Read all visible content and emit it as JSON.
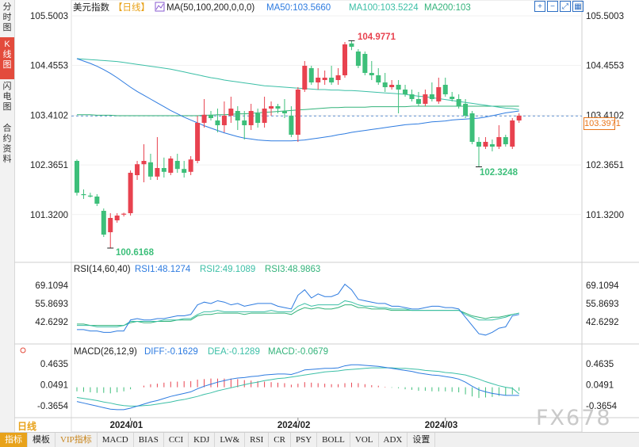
{
  "side_tabs": [
    {
      "label": "分时图",
      "active": false
    },
    {
      "label": "K线图",
      "active": true
    },
    {
      "label": "闪电图",
      "active": false
    },
    {
      "label": "合约资料",
      "active": false
    }
  ],
  "header": {
    "instrument": "美元指数",
    "period_tag": "【日线】",
    "ma_label": "MA(50,100,200,0,0,0)",
    "ma50": "MA50:103.5660",
    "ma100": "MA100:103.5224",
    "ma200": "MA200:103"
  },
  "price_axis_labels": [
    "105.5003",
    "104.4553",
    "103.4102",
    "102.3651",
    "101.3200"
  ],
  "current_price": "103.3971",
  "annotations": {
    "high": "104.9771",
    "low1": "100.6168",
    "low2": "102.3248"
  },
  "rsi_header": {
    "label": "RSI(14,60,40)",
    "rsi1": "RSI1:48.1274",
    "rsi2": "RSI2:49.1089",
    "rsi3": "RSI3:48.9863"
  },
  "rsi_axis_labels": [
    "69.1094",
    "55.8693",
    "42.6292"
  ],
  "macd_header": {
    "label": "MACD(26,12,9)",
    "diff": "DIFF:-0.1629",
    "dea": "DEA:-0.1289",
    "macd": "MACD:-0.0679"
  },
  "macd_axis_labels": [
    "0.4635",
    "0.0491",
    "-0.3654"
  ],
  "date_labels": [
    "2024/01",
    "2024/02",
    "2024/03"
  ],
  "period_button": "日线",
  "watermark": "FX678",
  "toolbar": [
    "指标",
    "模板",
    "VIP指标",
    "MACD",
    "BIAS",
    "CCI",
    "KDJ",
    "LW&",
    "RSI",
    "CR",
    "PSY",
    "BOLL",
    "VOL",
    "ADX",
    "设置"
  ],
  "colors": {
    "up": "#e8424f",
    "down": "#3dbf7a",
    "ma50": "#2d7be0",
    "ma100": "#3bbfa6",
    "ma200": "#33b37a",
    "accent": "#e8a21a"
  },
  "chart_data": {
    "type": "candlestick",
    "price_range": [
      100.5,
      105.5
    ],
    "candles": [
      {
        "o": 102.45,
        "h": 102.48,
        "l": 101.72,
        "c": 101.78
      },
      {
        "o": 101.75,
        "h": 101.85,
        "l": 101.65,
        "c": 101.73
      },
      {
        "o": 101.72,
        "h": 101.78,
        "l": 101.68,
        "c": 101.7
      },
      {
        "o": 101.7,
        "h": 101.75,
        "l": 101.5,
        "c": 101.55
      },
      {
        "o": 101.4,
        "h": 101.45,
        "l": 100.85,
        "c": 100.9
      },
      {
        "o": 100.95,
        "h": 101.35,
        "l": 100.62,
        "c": 101.25
      },
      {
        "o": 101.2,
        "h": 101.35,
        "l": 101.15,
        "c": 101.3
      },
      {
        "o": 101.32,
        "h": 101.36,
        "l": 101.28,
        "c": 101.34
      },
      {
        "o": 101.35,
        "h": 102.25,
        "l": 101.3,
        "c": 102.2
      },
      {
        "o": 102.15,
        "h": 102.45,
        "l": 102.05,
        "c": 102.38
      },
      {
        "o": 102.38,
        "h": 102.8,
        "l": 102.0,
        "c": 102.45
      },
      {
        "o": 102.42,
        "h": 102.6,
        "l": 102.05,
        "c": 102.12
      },
      {
        "o": 102.12,
        "h": 102.95,
        "l": 102.05,
        "c": 102.3
      },
      {
        "o": 102.3,
        "h": 102.52,
        "l": 102.1,
        "c": 102.22
      },
      {
        "o": 102.2,
        "h": 102.55,
        "l": 102.15,
        "c": 102.5
      },
      {
        "o": 102.45,
        "h": 102.6,
        "l": 102.2,
        "c": 102.28
      },
      {
        "o": 102.28,
        "h": 102.45,
        "l": 102.1,
        "c": 102.2
      },
      {
        "o": 102.22,
        "h": 102.55,
        "l": 102.15,
        "c": 102.48
      },
      {
        "o": 102.45,
        "h": 103.4,
        "l": 102.4,
        "c": 103.25
      },
      {
        "o": 103.25,
        "h": 103.75,
        "l": 103.15,
        "c": 103.42
      },
      {
        "o": 103.42,
        "h": 103.5,
        "l": 103.3,
        "c": 103.35
      },
      {
        "o": 103.3,
        "h": 103.55,
        "l": 103.05,
        "c": 103.2
      },
      {
        "o": 103.2,
        "h": 103.7,
        "l": 103.05,
        "c": 103.4
      },
      {
        "o": 103.4,
        "h": 103.8,
        "l": 103.25,
        "c": 103.55
      },
      {
        "o": 103.5,
        "h": 103.6,
        "l": 103.1,
        "c": 103.3
      },
      {
        "o": 103.3,
        "h": 103.5,
        "l": 102.9,
        "c": 103.2
      },
      {
        "o": 103.2,
        "h": 103.65,
        "l": 103.1,
        "c": 103.5
      },
      {
        "o": 103.45,
        "h": 103.55,
        "l": 103.15,
        "c": 103.25
      },
      {
        "o": 103.25,
        "h": 103.8,
        "l": 103.15,
        "c": 103.55
      },
      {
        "o": 103.55,
        "h": 103.7,
        "l": 103.4,
        "c": 103.6
      },
      {
        "o": 103.6,
        "h": 103.65,
        "l": 103.45,
        "c": 103.55
      },
      {
        "o": 103.5,
        "h": 103.75,
        "l": 103.35,
        "c": 103.45
      },
      {
        "o": 103.4,
        "h": 103.6,
        "l": 102.95,
        "c": 103.0
      },
      {
        "o": 103.0,
        "h": 104.0,
        "l": 102.85,
        "c": 103.95
      },
      {
        "o": 103.95,
        "h": 104.55,
        "l": 103.9,
        "c": 104.45
      },
      {
        "o": 104.4,
        "h": 104.45,
        "l": 104.05,
        "c": 104.1
      },
      {
        "o": 104.1,
        "h": 104.4,
        "l": 103.95,
        "c": 104.2
      },
      {
        "o": 104.15,
        "h": 104.35,
        "l": 104.05,
        "c": 104.2
      },
      {
        "o": 104.2,
        "h": 104.45,
        "l": 104.05,
        "c": 104.1
      },
      {
        "o": 104.15,
        "h": 104.4,
        "l": 104.05,
        "c": 104.25
      },
      {
        "o": 104.25,
        "h": 104.95,
        "l": 104.2,
        "c": 104.9
      },
      {
        "o": 104.92,
        "h": 104.98,
        "l": 104.78,
        "c": 104.85
      },
      {
        "o": 104.75,
        "h": 104.8,
        "l": 104.4,
        "c": 104.45
      },
      {
        "o": 104.7,
        "h": 104.75,
        "l": 104.25,
        "c": 104.3
      },
      {
        "o": 104.3,
        "h": 104.55,
        "l": 104.15,
        "c": 104.25
      },
      {
        "o": 104.25,
        "h": 104.4,
        "l": 104.05,
        "c": 104.1
      },
      {
        "o": 104.1,
        "h": 104.3,
        "l": 103.9,
        "c": 104.0
      },
      {
        "o": 104.0,
        "h": 104.15,
        "l": 103.95,
        "c": 104.05
      },
      {
        "o": 104.05,
        "h": 104.15,
        "l": 103.45,
        "c": 103.95
      },
      {
        "o": 103.95,
        "h": 104.05,
        "l": 103.8,
        "c": 103.85
      },
      {
        "o": 103.85,
        "h": 103.95,
        "l": 103.7,
        "c": 103.75
      },
      {
        "o": 103.75,
        "h": 103.9,
        "l": 103.6,
        "c": 103.65
      },
      {
        "o": 103.65,
        "h": 103.95,
        "l": 103.6,
        "c": 103.85
      },
      {
        "o": 103.85,
        "h": 104.1,
        "l": 103.7,
        "c": 103.75
      },
      {
        "o": 103.7,
        "h": 104.2,
        "l": 103.65,
        "c": 104.0
      },
      {
        "o": 104.05,
        "h": 104.2,
        "l": 103.8,
        "c": 103.85
      },
      {
        "o": 103.8,
        "h": 103.9,
        "l": 103.7,
        "c": 103.75
      },
      {
        "o": 103.75,
        "h": 103.85,
        "l": 103.55,
        "c": 103.6
      },
      {
        "o": 103.65,
        "h": 103.75,
        "l": 103.35,
        "c": 103.4
      },
      {
        "o": 103.45,
        "h": 103.5,
        "l": 102.8,
        "c": 102.85
      },
      {
        "o": 102.85,
        "h": 102.95,
        "l": 102.32,
        "c": 102.75
      },
      {
        "o": 102.75,
        "h": 102.95,
        "l": 102.7,
        "c": 102.85
      },
      {
        "o": 102.8,
        "h": 102.9,
        "l": 102.65,
        "c": 102.75
      },
      {
        "o": 102.75,
        "h": 103.2,
        "l": 102.7,
        "c": 102.95
      },
      {
        "o": 102.95,
        "h": 103.0,
        "l": 102.75,
        "c": 102.8
      },
      {
        "o": 102.75,
        "h": 103.35,
        "l": 102.7,
        "c": 103.3
      },
      {
        "o": 103.3,
        "h": 103.45,
        "l": 103.25,
        "c": 103.4
      }
    ],
    "ma50": [
      104.6,
      104.55,
      104.5,
      104.44,
      104.37,
      104.29,
      104.2,
      104.1,
      104.0,
      103.91,
      103.83,
      103.75,
      103.67,
      103.59,
      103.51,
      103.44,
      103.37,
      103.31,
      103.25,
      103.19,
      103.14,
      103.09,
      103.04,
      103.0,
      102.96,
      102.93,
      102.91,
      102.89,
      102.88,
      102.87,
      102.87,
      102.87,
      102.87,
      102.88,
      102.89,
      102.91,
      102.93,
      102.95,
      102.97,
      103.0,
      103.02,
      103.05,
      103.07,
      103.09,
      103.11,
      103.13,
      103.15,
      103.17,
      103.19,
      103.21,
      103.22,
      103.23,
      103.25,
      103.27,
      103.28,
      103.29,
      103.31,
      103.32,
      103.33,
      103.34,
      103.35,
      103.37,
      103.4,
      103.43,
      103.46,
      103.48,
      103.5
    ],
    "ma100": [
      104.6,
      104.59,
      104.58,
      104.57,
      104.56,
      104.55,
      104.54,
      104.52,
      104.5,
      104.48,
      104.46,
      104.44,
      104.42,
      104.4,
      104.38,
      104.35,
      104.32,
      104.29,
      104.26,
      104.23,
      104.2,
      104.18,
      104.15,
      104.13,
      104.11,
      104.09,
      104.07,
      104.05,
      104.03,
      104.02,
      104.01,
      104.0,
      103.99,
      103.98,
      103.97,
      103.96,
      103.95,
      103.95,
      103.94,
      103.94,
      103.93,
      103.93,
      103.92,
      103.91,
      103.9,
      103.89,
      103.88,
      103.87,
      103.86,
      103.85,
      103.83,
      103.81,
      103.8,
      103.78,
      103.76,
      103.74,
      103.72,
      103.7,
      103.68,
      103.66,
      103.64,
      103.62,
      103.6,
      103.58,
      103.56,
      103.55,
      103.53
    ],
    "ma200": [
      103.42,
      103.42,
      103.42,
      103.41,
      103.41,
      103.41,
      103.4,
      103.4,
      103.4,
      103.4,
      103.4,
      103.4,
      103.4,
      103.4,
      103.4,
      103.4,
      103.4,
      103.4,
      103.4,
      103.41,
      103.41,
      103.42,
      103.42,
      103.43,
      103.44,
      103.44,
      103.45,
      103.46,
      103.47,
      103.48,
      103.49,
      103.5,
      103.51,
      103.52,
      103.53,
      103.54,
      103.55,
      103.56,
      103.57,
      103.57,
      103.58,
      103.58,
      103.58,
      103.58,
      103.59,
      103.59,
      103.59,
      103.59,
      103.59,
      103.59,
      103.6,
      103.6,
      103.6,
      103.6,
      103.6,
      103.6,
      103.6,
      103.6,
      103.6,
      103.6,
      103.6,
      103.6,
      103.6,
      103.6,
      103.6,
      103.6,
      103.6
    ],
    "rsi_range": [
      30,
      75
    ],
    "rsi1": [
      37,
      37,
      36,
      36,
      35,
      35,
      36,
      36,
      44,
      45,
      44,
      44,
      45,
      45,
      46,
      47,
      47,
      48,
      55,
      57,
      56,
      58,
      57,
      55,
      56,
      54,
      55,
      56,
      56,
      56,
      54,
      53,
      52,
      62,
      66,
      60,
      63,
      61,
      61,
      63,
      70,
      66,
      59,
      58,
      57,
      56,
      56,
      54,
      54,
      53,
      52,
      52,
      53,
      54,
      54,
      53,
      53,
      52,
      46,
      40,
      34,
      33,
      35,
      38,
      39,
      47,
      48
    ],
    "rsi2": [
      40,
      40,
      40,
      39,
      39,
      39,
      39,
      40,
      43,
      43,
      43,
      43,
      43,
      44,
      44,
      44,
      45,
      45,
      48,
      50,
      50,
      51,
      50,
      50,
      50,
      50,
      50,
      50,
      50,
      51,
      50,
      50,
      50,
      54,
      56,
      54,
      55,
      55,
      55,
      55,
      58,
      57,
      55,
      54,
      54,
      53,
      53,
      52,
      52,
      52,
      51,
      51,
      51,
      51,
      51,
      51,
      51,
      51,
      48,
      46,
      44,
      44,
      44,
      45,
      46,
      48,
      49
    ],
    "rsi3": [
      41,
      41,
      40,
      40,
      40,
      40,
      40,
      40,
      42,
      43,
      42,
      42,
      43,
      43,
      43,
      44,
      44,
      44,
      47,
      48,
      48,
      49,
      49,
      49,
      49,
      48,
      49,
      49,
      49,
      49,
      49,
      49,
      48,
      51,
      53,
      52,
      53,
      52,
      52,
      53,
      55,
      55,
      53,
      53,
      52,
      52,
      52,
      51,
      51,
      51,
      51,
      51,
      51,
      51,
      51,
      51,
      51,
      51,
      49,
      47,
      46,
      45,
      46,
      46,
      47,
      48,
      49
    ],
    "macd_range": [
      -0.55,
      0.6
    ],
    "diff": [
      -0.28,
      -0.31,
      -0.34,
      -0.37,
      -0.4,
      -0.43,
      -0.44,
      -0.44,
      -0.41,
      -0.37,
      -0.33,
      -0.29,
      -0.26,
      -0.22,
      -0.18,
      -0.15,
      -0.12,
      -0.09,
      -0.03,
      0.02,
      0.06,
      0.1,
      0.13,
      0.16,
      0.18,
      0.19,
      0.21,
      0.22,
      0.24,
      0.25,
      0.26,
      0.26,
      0.25,
      0.29,
      0.34,
      0.35,
      0.36,
      0.37,
      0.37,
      0.38,
      0.42,
      0.44,
      0.44,
      0.43,
      0.42,
      0.41,
      0.39,
      0.37,
      0.35,
      0.33,
      0.31,
      0.28,
      0.26,
      0.24,
      0.23,
      0.21,
      0.19,
      0.16,
      0.1,
      0.02,
      -0.05,
      -0.09,
      -0.12,
      -0.14,
      -0.16,
      -0.16,
      -0.16
    ],
    "dea": [
      -0.2,
      -0.22,
      -0.24,
      -0.26,
      -0.29,
      -0.31,
      -0.34,
      -0.36,
      -0.37,
      -0.37,
      -0.36,
      -0.35,
      -0.33,
      -0.31,
      -0.29,
      -0.26,
      -0.24,
      -0.21,
      -0.18,
      -0.14,
      -0.11,
      -0.07,
      -0.04,
      -0.01,
      0.02,
      0.05,
      0.08,
      0.1,
      0.13,
      0.15,
      0.17,
      0.18,
      0.2,
      0.22,
      0.24,
      0.26,
      0.28,
      0.3,
      0.31,
      0.32,
      0.34,
      0.35,
      0.36,
      0.37,
      0.38,
      0.38,
      0.38,
      0.38,
      0.37,
      0.37,
      0.36,
      0.35,
      0.33,
      0.32,
      0.31,
      0.29,
      0.28,
      0.26,
      0.24,
      0.2,
      0.16,
      0.11,
      0.07,
      0.03,
      0.0,
      -0.02,
      -0.13
    ],
    "macd": [
      -0.08,
      -0.09,
      -0.1,
      -0.11,
      -0.11,
      -0.12,
      -0.1,
      -0.08,
      -0.04,
      0.0,
      0.03,
      0.06,
      0.07,
      0.09,
      0.11,
      0.11,
      0.12,
      0.12,
      0.15,
      0.16,
      0.17,
      0.17,
      0.17,
      0.17,
      0.16,
      0.14,
      0.13,
      0.12,
      0.11,
      0.1,
      0.09,
      0.08,
      0.05,
      0.07,
      0.1,
      0.09,
      0.08,
      0.07,
      0.06,
      0.06,
      0.08,
      0.09,
      0.08,
      0.06,
      0.04,
      0.03,
      0.01,
      -0.01,
      -0.02,
      -0.04,
      -0.05,
      -0.07,
      -0.07,
      -0.08,
      -0.08,
      -0.08,
      -0.09,
      -0.1,
      -0.14,
      -0.18,
      -0.21,
      -0.2,
      -0.19,
      -0.17,
      -0.16,
      -0.14,
      -0.07
    ]
  }
}
